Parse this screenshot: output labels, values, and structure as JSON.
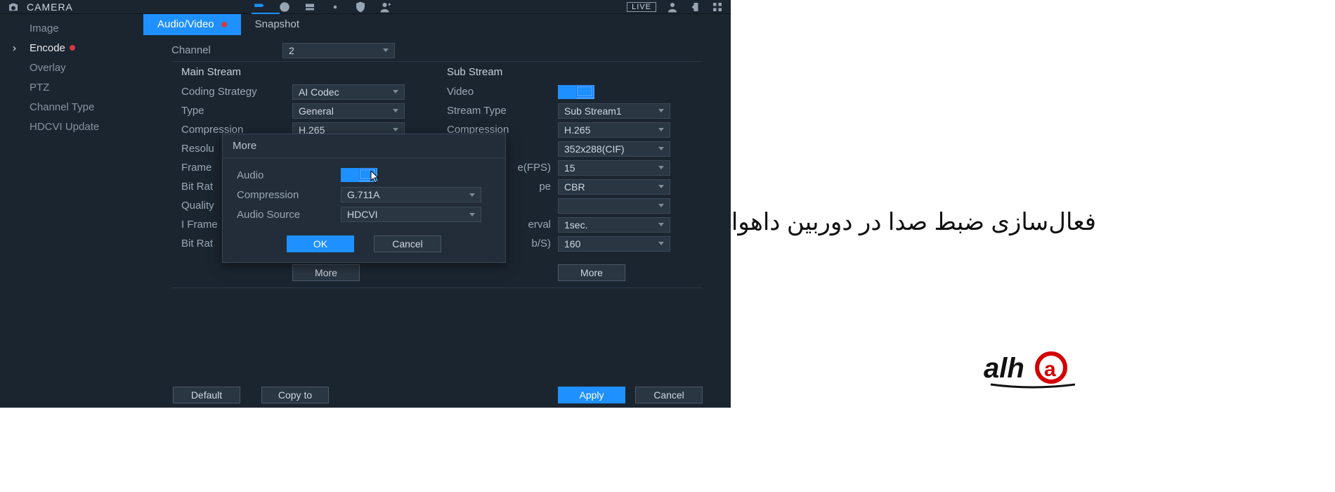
{
  "header": {
    "title": "CAMERA",
    "live": "LIVE"
  },
  "sidebar": {
    "items": [
      {
        "label": "Image"
      },
      {
        "label": "Encode"
      },
      {
        "label": "Overlay"
      },
      {
        "label": "PTZ"
      },
      {
        "label": "Channel Type"
      },
      {
        "label": "HDCVI Update"
      }
    ]
  },
  "tabs": {
    "a": "Audio/Video",
    "b": "Snapshot"
  },
  "form": {
    "channel_label": "Channel",
    "channel_value": "2",
    "main": {
      "head": "Main Stream",
      "coding_strategy_label": "Coding Strategy",
      "coding_strategy_value": "AI Codec",
      "type_label": "Type",
      "type_value": "General",
      "compression_label": "Compression",
      "compression_value": "H.265",
      "resolution_label": "Resolu",
      "framerate_label": "Frame",
      "bitrate_type_label": "Bit Rat",
      "quality_label": "Quality",
      "iframe_label": "I Frame",
      "bitrate_label": "Bit Rat",
      "more_label": "More"
    },
    "sub": {
      "head": "Sub Stream",
      "video_label": "Video",
      "stream_type_label": "Stream Type",
      "stream_type_value": "Sub Stream1",
      "compression_label": "Compression",
      "compression_value": "H.265",
      "resolution_value": "352x288(CIF)",
      "fps_label": "e(FPS)",
      "fps_value": "15",
      "brtype_label": "pe",
      "brtype_value": "CBR",
      "quality_value": "",
      "interval_label": "erval",
      "interval_value": "1sec.",
      "kbps_label": "b/S)",
      "kbps_value": "160",
      "more_label": "More"
    }
  },
  "modal": {
    "title": "More",
    "audio_label": "Audio",
    "compression_label": "Compression",
    "compression_value": "G.711A",
    "source_label": "Audio Source",
    "source_value": "HDCVI",
    "ok": "OK",
    "cancel": "Cancel"
  },
  "footer": {
    "default": "Default",
    "copyto": "Copy to",
    "apply": "Apply",
    "cancel": "Cancel"
  },
  "caption": "فعال‌سازی ضبط صدا در دوربین داهوا"
}
